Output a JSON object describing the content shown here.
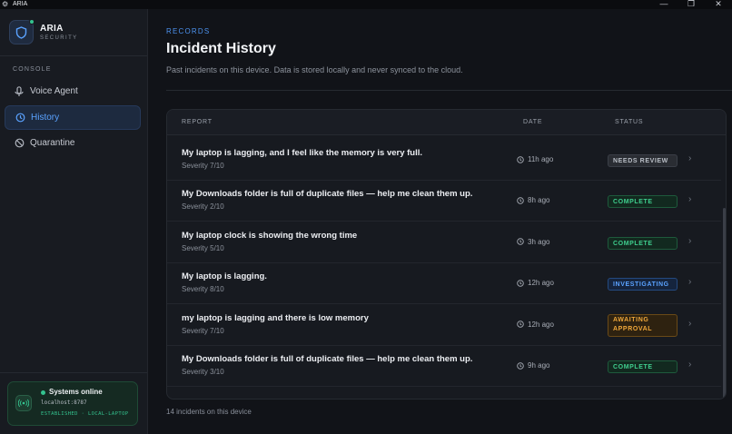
{
  "window": {
    "title": "ARIA",
    "controls": [
      "—",
      "❐",
      "✕"
    ]
  },
  "brand": {
    "name": "ARIA",
    "subtitle": "SECURITY"
  },
  "sidebar": {
    "section": "CONSOLE",
    "items": [
      {
        "label": "Voice Agent",
        "icon": "mic-icon",
        "active": false
      },
      {
        "label": "History",
        "icon": "history-icon",
        "active": true
      },
      {
        "label": "Quarantine",
        "icon": "quarantine-icon",
        "active": false
      }
    ],
    "status": {
      "title": "Systems online",
      "host": "localhost:8787",
      "connection": "ESTABLISHED · LOCAL-LAPTOP"
    }
  },
  "header": {
    "eyebrow": "RECORDS",
    "title": "Incident History",
    "subtitle": "Past incidents on this device. Data is stored locally and never synced to the cloud."
  },
  "table": {
    "columns": {
      "report": "REPORT",
      "date": "DATE",
      "status": "STATUS"
    },
    "rows": [
      {
        "title": "My laptop is lagging, and I feel like the memory is very full.",
        "severity": "Severity 7/10",
        "date": "11h ago",
        "status": "NEEDS REVIEW",
        "status_kind": "review"
      },
      {
        "title": "My Downloads folder is full of duplicate files — help me clean them up.",
        "severity": "Severity 2/10",
        "date": "8h ago",
        "status": "COMPLETE",
        "status_kind": "complete"
      },
      {
        "title": "My laptop clock is showing the wrong time",
        "severity": "Severity 5/10",
        "date": "3h ago",
        "status": "COMPLETE",
        "status_kind": "complete"
      },
      {
        "title": "My laptop is lagging.",
        "severity": "Severity 8/10",
        "date": "12h ago",
        "status": "INVESTIGATING",
        "status_kind": "investigating"
      },
      {
        "title": "my laptop is lagging and there is low memory",
        "severity": "Severity 7/10",
        "date": "12h ago",
        "status": "AWAITING APPROVAL",
        "status_kind": "awaiting"
      },
      {
        "title": "My Downloads folder is full of duplicate files — help me clean them up.",
        "severity": "Severity 3/10",
        "date": "9h ago",
        "status": "COMPLETE",
        "status_kind": "complete"
      }
    ],
    "footer": "14 incidents on this device"
  },
  "colors": {
    "accent": "#4d93f0",
    "online": "#34c38f",
    "review": {
      "bg": "#2a2d33",
      "border": "#3a3e46",
      "text": "#b9bec6"
    },
    "complete": {
      "bg": "#12291f",
      "border": "#1e5a3c",
      "text": "#3fcf8e"
    },
    "investigating": {
      "bg": "#15243d",
      "border": "#244a80",
      "text": "#5aa2ff"
    },
    "awaiting": {
      "bg": "#2e2210",
      "border": "#6a4a17",
      "text": "#f0a83a"
    }
  }
}
